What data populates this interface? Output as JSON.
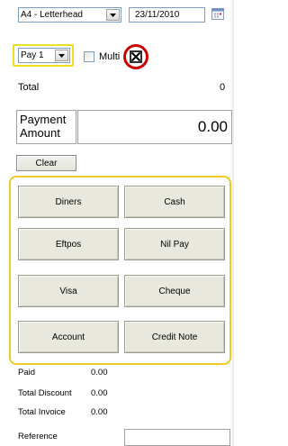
{
  "header": {
    "template_select": "A4 - Letterhead",
    "date": "23/11/2010",
    "pay_select": "Pay 1",
    "multi_label": "Multi"
  },
  "total": {
    "label": "Total",
    "value": "0"
  },
  "payment": {
    "label": "Payment Amount",
    "value": "0.00"
  },
  "clear_label": "Clear",
  "pay_methods": {
    "diners": "Diners",
    "cash": "Cash",
    "eftpos": "Eftpos",
    "nilpay": "Nil Pay",
    "visa": "Visa",
    "cheque": "Cheque",
    "account": "Account",
    "creditnote": "Credit Note"
  },
  "summary": {
    "paid_label": "Paid",
    "paid_value": "0.00",
    "discount_label": "Total Discount",
    "discount_value": "0.00",
    "invoice_label": "Total Invoice",
    "invoice_value": "0.00"
  },
  "reference": {
    "label": "Reference",
    "value": ""
  },
  "colors": {
    "highlight": "#f2de1d",
    "panel_border": "#f0cc20",
    "close_ring": "#cc0000"
  }
}
